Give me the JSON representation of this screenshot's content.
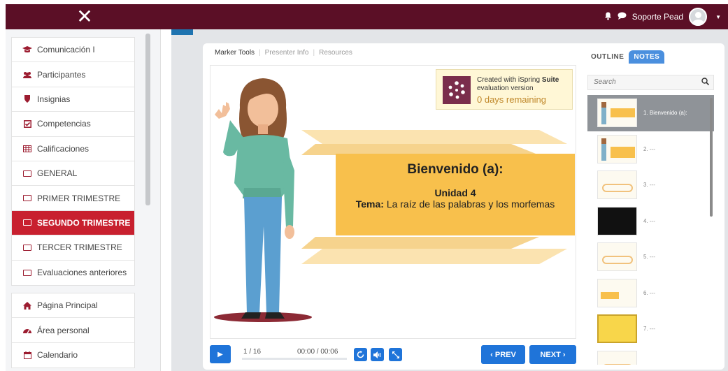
{
  "topbar": {
    "close_glyph": "✕",
    "user_name": "Soporte Pead",
    "icons": [
      "bell-icon",
      "chat-icon",
      "avatar",
      "caret-down-icon"
    ]
  },
  "sidebar": {
    "group1": [
      {
        "label": "Comunicación I",
        "icon": "graduation-cap-icon"
      },
      {
        "label": "Participantes",
        "icon": "users-icon"
      },
      {
        "label": "Insignias",
        "icon": "shield-icon"
      },
      {
        "label": "Competencias",
        "icon": "check-square-icon"
      },
      {
        "label": "Calificaciones",
        "icon": "table-icon"
      },
      {
        "label": "GENERAL",
        "icon": "folder-icon"
      },
      {
        "label": "PRIMER TRIMESTRE",
        "icon": "folder-icon"
      },
      {
        "label": "SEGUNDO TRIMESTRE",
        "icon": "folder-icon",
        "active": true
      },
      {
        "label": "TERCER TRIMESTRE",
        "icon": "folder-icon"
      },
      {
        "label": "Evaluaciones anteriores",
        "icon": "folder-icon"
      }
    ],
    "group2": [
      {
        "label": "Página Principal",
        "icon": "home-icon"
      },
      {
        "label": "Área personal",
        "icon": "dashboard-icon"
      },
      {
        "label": "Calendario",
        "icon": "calendar-icon"
      }
    ],
    "active_color": "#c8202f"
  },
  "player": {
    "tabs": [
      "Marker Tools",
      "Presenter Info",
      "Resources"
    ],
    "evaluation": {
      "line1_prefix": "Created with iSpring",
      "line1_bold": "Suite",
      "line2": "evaluation version",
      "line3": "0 days remaining"
    },
    "slide": {
      "title": "Bienvenido (a):",
      "unit": "Unidad 4",
      "topic_label": "Tema:",
      "topic_text": "La raíz de las palabras y los morfemas"
    },
    "controls": {
      "slide_counter": "1 / 16",
      "time": "00:00 / 00:06",
      "prev_label": "‹ PREV",
      "next_label": "NEXT ›"
    },
    "accent_color": "#1f74d9"
  },
  "outline": {
    "tabs": [
      "OUTLINE",
      "NOTES"
    ],
    "search_placeholder": "Search",
    "items": [
      {
        "label": "1. Bienvenido (a):",
        "style": "title",
        "selected": true
      },
      {
        "label": "2. ---",
        "style": "title"
      },
      {
        "label": "3. ---",
        "style": "dots"
      },
      {
        "label": "4. ---",
        "style": "black"
      },
      {
        "label": "5. ---",
        "style": "dots"
      },
      {
        "label": "6. ---",
        "style": "title"
      },
      {
        "label": "7. ---",
        "style": "yellow"
      },
      {
        "label": "",
        "style": "dots"
      }
    ]
  }
}
